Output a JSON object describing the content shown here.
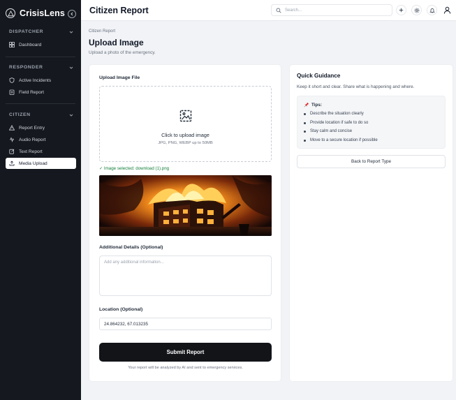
{
  "app": {
    "name": "CrisisLens"
  },
  "sidebar": {
    "sections": [
      {
        "title": "DISPATCHER",
        "items": [
          {
            "label": "Dashboard",
            "icon": "dashboard-icon"
          }
        ]
      },
      {
        "title": "RESPONDER",
        "items": [
          {
            "label": "Active Incidents",
            "icon": "shield-icon"
          },
          {
            "label": "Field Report",
            "icon": "clipboard-icon"
          }
        ]
      },
      {
        "title": "CITIZEN",
        "items": [
          {
            "label": "Report Entry",
            "icon": "alert-triangle-icon"
          },
          {
            "label": "Audio Report",
            "icon": "audio-wave-icon"
          },
          {
            "label": "Text Report",
            "icon": "edit-icon"
          },
          {
            "label": "Media Upload",
            "icon": "upload-icon",
            "active": true
          }
        ]
      }
    ]
  },
  "header": {
    "title": "Citizen Report",
    "search_placeholder": "Search..."
  },
  "page": {
    "breadcrumb": "Citizen Report",
    "title": "Upload Image",
    "subtitle": "Upload a photo of the emergency."
  },
  "form": {
    "upload_label": "Upload Image File",
    "dropzone_title": "Click to upload image",
    "dropzone_hint": "JPG, PNG, WEBP up to 50MB",
    "selected_file": "✓ Image selected: download (1).png",
    "details_label": "Additional Details (Optional)",
    "details_placeholder": "Add any additional information...",
    "location_label": "Location (Optional)",
    "location_value": "24.864232, 67.013235",
    "submit_label": "Submit Report",
    "footnote": "Your report will be analyzed by AI and sent to emergency services."
  },
  "guidance": {
    "title": "Quick Guidance",
    "subtitle": "Keep it short and clear. Share what is happening and where.",
    "tips_heading": "Tips:",
    "tips": [
      "Describe the situation clearly",
      "Provide location if safe to do so",
      "Stay calm and concise",
      "Move to a secure location if possible"
    ],
    "back_label": "Back to Report Type"
  },
  "colors": {
    "sidebar_bg": "#15181e",
    "success": "#15803d",
    "submit_bg": "#121418",
    "page_bg": "#f1f3f6"
  }
}
